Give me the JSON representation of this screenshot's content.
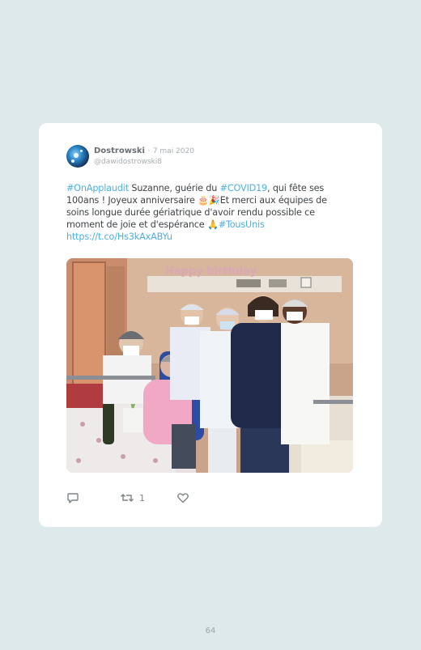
{
  "tweet": {
    "author_name": "Dostrowski",
    "separator": "·",
    "date": "7 mai 2020",
    "handle": "@dawidostrowski8",
    "text": {
      "hashtag1": "#OnApplaudit",
      "part1": " Suzanne, guérie du ",
      "hashtag2": "#COVID19",
      "part2": ", qui fête ses 100ans ! Joyeux anniversaire ",
      "emoji1": "🎂🎉",
      "part3": "Et merci aux équipes de soins longue durée gériatrique d'avoir rendu possible ce moment de joie et d'espérance ",
      "emoji2": "🙏",
      "hashtag3": "#TousUnis",
      "link": "https://t.co/Hs3kAxABYu"
    },
    "photo_banner_text": "Happy birthday",
    "actions": {
      "reply_icon": "reply-icon",
      "retweet_icon": "retweet-icon",
      "retweet_count": "1",
      "like_icon": "heart-icon"
    }
  },
  "page_number": "64",
  "colors": {
    "page_background": "#dde9ea",
    "card_background": "#ffffff",
    "link": "#4ab0e6",
    "muted": "#a7adb2"
  }
}
